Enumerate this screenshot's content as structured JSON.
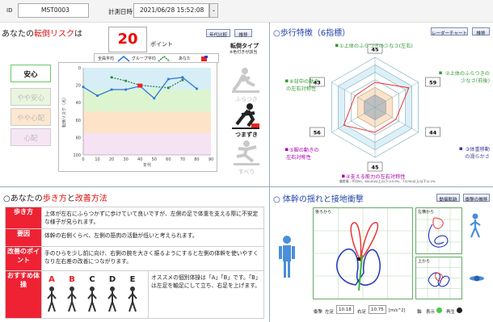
{
  "header": {
    "id_label": "ID",
    "id_value": "MST0003",
    "date_label": "計測日時",
    "date_value": "2021/06/28 15:52:08",
    "date_dropdown": "⌄"
  },
  "risk": {
    "title_prefix": "あなたの",
    "title_emph": "転倒リスク",
    "title_suffix": "は",
    "score": "20",
    "score_unit": "ポイント",
    "btn_age": "年代比較",
    "btn_trend": "推移",
    "type_title": "転倒タイプ",
    "type_note": "※色付きが該当",
    "levels": [
      "安心",
      "やや安心",
      "やや心配",
      "心配"
    ],
    "legend": {
      "all": "全員平均",
      "group": "グループ平均",
      "you": "あなた"
    },
    "ylabel": "転倒リスク（点）",
    "xlabel": "年代",
    "fall_types": [
      "ふらつき",
      "つまずき",
      "すべり"
    ],
    "chart_data": {
      "type": "line",
      "x": [
        0,
        10,
        20,
        30,
        40,
        50,
        60,
        70,
        80
      ],
      "xlim": [
        0,
        90
      ],
      "ylim": [
        0,
        100
      ],
      "y_inverted": true,
      "yticks": [
        0,
        20,
        40,
        60,
        80,
        100
      ],
      "xticks": [
        0,
        10,
        20,
        30,
        40,
        50,
        60,
        70,
        80,
        90
      ],
      "bands": [
        {
          "from": 0,
          "to": 25,
          "color": "#d7eef7"
        },
        {
          "from": 25,
          "to": 50,
          "color": "#dcf5d0"
        },
        {
          "from": 50,
          "to": 75,
          "color": "#fde3c8"
        },
        {
          "from": 75,
          "to": 100,
          "color": "#f5e3f3"
        }
      ],
      "series": [
        {
          "name": "全員平均",
          "color": "#2b78d8",
          "x": [
            0,
            10,
            20,
            30,
            40,
            50,
            60,
            70,
            80
          ],
          "values": [
            22,
            32,
            25,
            25,
            21,
            35,
            13,
            11,
            24
          ]
        },
        {
          "name": "グループ平均",
          "color": "#2a8a3a",
          "x": [
            20,
            30,
            40,
            60,
            70
          ],
          "values": [
            11,
            15,
            20,
            23,
            14
          ]
        },
        {
          "name": "あなた",
          "color": "#e22",
          "x": [
            40
          ],
          "values": [
            20
          ]
        }
      ]
    }
  },
  "gait": {
    "title": "○歩行特徴（6指標）",
    "btn_radar": "レーダーチャート",
    "btn_trend": "推移",
    "labels": [
      "①上体のふらつきの少なさ(左右)",
      "②上体のふらつきの少なさ(前後)",
      "③体重移動の滑らかさ",
      "④支える能力の左右対称性",
      "⑤脚の動きの左右対称性",
      "⑥背中の動きの左右対称性"
    ],
    "values": [
      "45",
      "59",
      "44",
      "45",
      "56",
      "43"
    ],
    "footnote": "偏差値…平均50、60(40)以上(以下)15.9%、70(30)以上(以下)2.2%",
    "chart_data": {
      "type": "radar",
      "axes": [
        "①",
        "②",
        "③",
        "④",
        "⑤",
        "⑥"
      ],
      "values": [
        45,
        59,
        44,
        45,
        56,
        43
      ]
    }
  },
  "advice": {
    "title_prefix": "○あなたの",
    "title_emph": "歩き方",
    "title_mid": "と",
    "title_emph2": "改善方法",
    "rows": [
      {
        "tag": "歩き方",
        "text": "上体が左右にふらつかずに歩けていて良いですが、左側の足で体重を支える際に不安定な様子が見られます。"
      },
      {
        "tag": "要因",
        "text": "体幹の右側くらべ、左側の筋肉の活動が低いと考えられます。"
      },
      {
        "tag": "改善のポイント",
        "text": "手のひらを少し前に向け、右側の腕を大きく振るようにすると左側の体幹を使いやすくなり左右差の改善につながります。"
      },
      {
        "tag": "おすすめ体操",
        "text": "オススメの個別体操は「A」「B」です。「B」は左足を軸足にして立ち、右足を上げます。"
      }
    ],
    "exercises": [
      "A",
      "B",
      "C",
      "D",
      "E"
    ]
  },
  "trunk": {
    "title": "○ 体幹の揺れと接地衝撃",
    "btn1": "動揺軌跡",
    "btn2": "衝撃の推移",
    "view_back": "後ろから",
    "view_left": "左横から",
    "view_top": "上から",
    "impact_label": "衝撃",
    "left_label": "左足",
    "left_value": "10.18",
    "right_label": "右足",
    "right_value": "10.75",
    "unit": "[m/s^2]",
    "axis_label": "軸",
    "show_label": "表示",
    "play_label": "再生"
  }
}
